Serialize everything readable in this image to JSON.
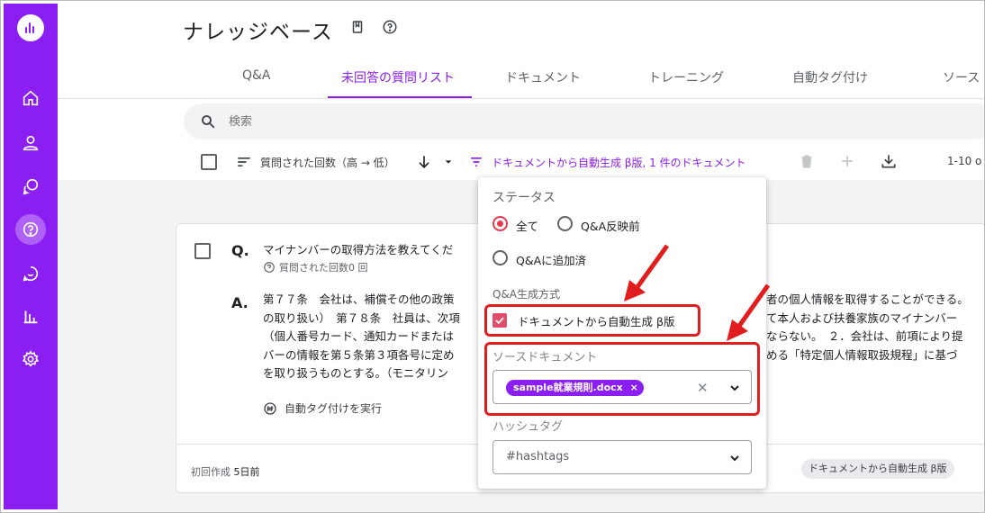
{
  "header": {
    "title": "ナレッジベース"
  },
  "tabs": [
    "Q&A",
    "未回答の質問リスト",
    "ドキュメント",
    "トレーニング",
    "自動タグ付け",
    "ソース"
  ],
  "search": {
    "placeholder": "検索"
  },
  "toolbar": {
    "sort_label": "質問された回数（高 → 低）",
    "filter_label": "ドキュメントから自動生成 β版, 1 件のドキュメント",
    "pagination": "1-10 o"
  },
  "card": {
    "q_label": "Q.",
    "question": "マイナンバーの取得方法を教えてくだ",
    "asked_count": "質問された回数0 回",
    "a_label": "A.",
    "answer_lines": [
      "第７７条　会社は、補償その他の政策",
      "の取り扱い）　第７８条　社員は、次項",
      "（個人番号カード、通知カードまたは",
      "バーの情報を第５条第３項各号に定め",
      "を取り扱うものとする。（モニタリン"
    ],
    "answer_right_lines": [
      "者の個人情報を取得することができる。",
      "て本人および扶養家族のマイナンバー",
      "ならない。　２．会社は、前項により提",
      "める「特定個人情報取扱規程」に基づ",
      ""
    ],
    "auto_tag_label": "自動タグ付けを実行",
    "created_prefix": "初回作成",
    "created_value": "5日前",
    "source_tag": "ドキュメントから自動生成 β版"
  },
  "popup": {
    "status_heading": "ステータス",
    "status_all": "全て",
    "status_before": "Q&A反映前",
    "status_added": "Q&Aに追加済",
    "method_heading": "Q&A生成方式",
    "method_auto": "ドキュメントから自動生成 β版",
    "source_label": "ソースドキュメント",
    "source_chip": "sample就業規則.docx",
    "hashtag_label": "ハッシュタグ",
    "hashtag_placeholder": "#hashtags"
  },
  "colors": {
    "brand": "#8b1ef0",
    "annotation": "#e01e1e",
    "checkbox": "#e04d6a"
  }
}
